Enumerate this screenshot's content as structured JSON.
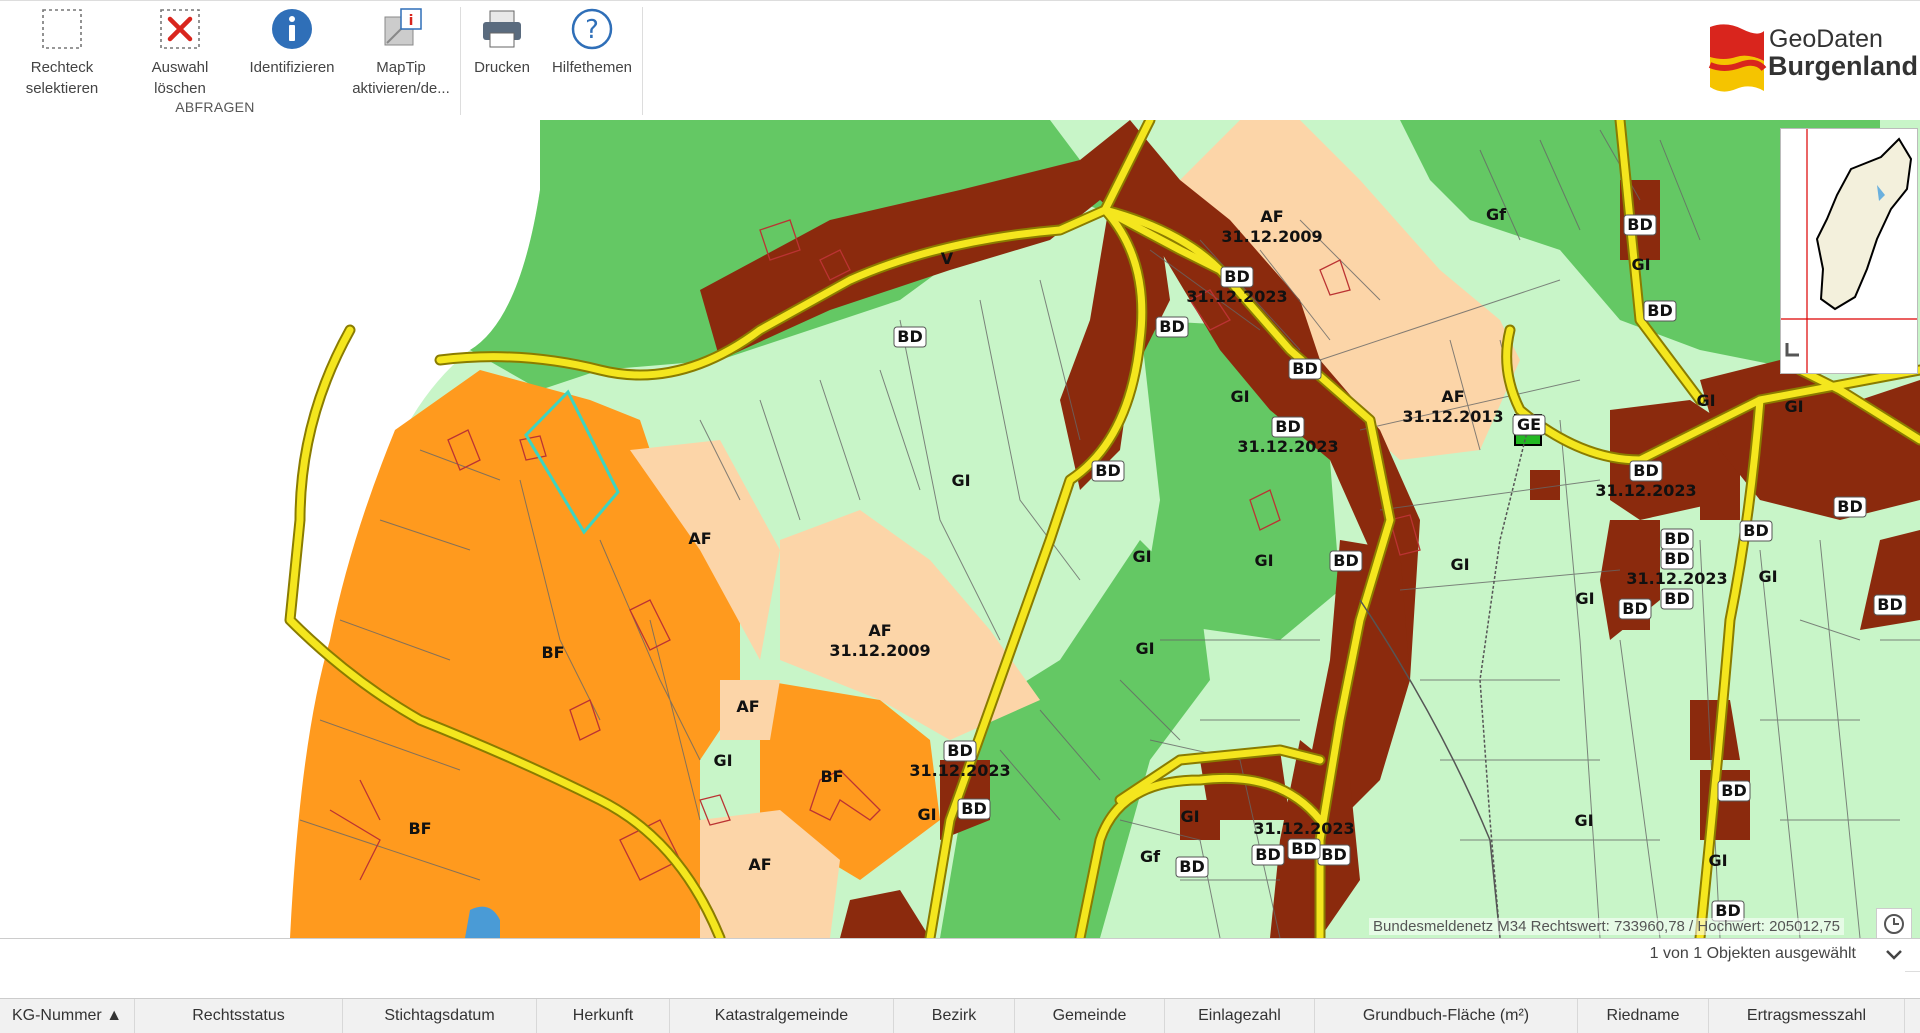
{
  "toolbar": {
    "buttons": [
      {
        "label": "Rechteck selektieren",
        "icon": "rectangle-select-icon"
      },
      {
        "label": "Auswahl löschen",
        "icon": "clear-selection-icon"
      },
      {
        "label": "Identifizieren",
        "icon": "info-icon"
      },
      {
        "label": "MapTip aktivieren/de...",
        "icon": "maptip-icon"
      },
      {
        "label": "Drucken",
        "icon": "printer-icon"
      },
      {
        "label": "Hilfethemen",
        "icon": "help-icon"
      }
    ],
    "group_label": "ABFRAGEN"
  },
  "logo": {
    "line1": "GeoDaten",
    "line2": "Burgenland",
    "colors": [
      "#d9251d",
      "#f5c400"
    ]
  },
  "map": {
    "labels": [
      {
        "text": "V"
      },
      {
        "text": "BD"
      },
      {
        "text": "AF"
      },
      {
        "text": "31.12.2009"
      },
      {
        "text": "BD"
      },
      {
        "text": "31.12.2023"
      },
      {
        "text": "BD"
      },
      {
        "text": "BD"
      },
      {
        "text": "GI"
      },
      {
        "text": "BD"
      },
      {
        "text": "31.12.2023"
      },
      {
        "text": "AF"
      },
      {
        "text": "31.12.2013"
      },
      {
        "text": "GI"
      },
      {
        "text": "Gf"
      },
      {
        "text": "BD"
      },
      {
        "text": "BD"
      },
      {
        "text": "GI"
      },
      {
        "text": "GI"
      },
      {
        "text": "AF"
      },
      {
        "text": "BF"
      },
      {
        "text": "AF"
      },
      {
        "text": "31.12.2009"
      },
      {
        "text": "AF"
      },
      {
        "text": "GI"
      },
      {
        "text": "BF"
      },
      {
        "text": "BD"
      },
      {
        "text": "31.12.2023"
      },
      {
        "text": "GI"
      },
      {
        "text": "BD"
      },
      {
        "text": "BF"
      },
      {
        "text": "AF"
      },
      {
        "text": "GI"
      },
      {
        "text": "BD"
      },
      {
        "text": "GI"
      },
      {
        "text": "GE"
      },
      {
        "text": "GI"
      },
      {
        "text": "GI"
      },
      {
        "text": "BD"
      },
      {
        "text": "31.12.2023"
      },
      {
        "text": "BD"
      },
      {
        "text": "BD"
      },
      {
        "text": "31.12.2023"
      },
      {
        "text": "BD"
      },
      {
        "text": "BD"
      },
      {
        "text": "GI"
      },
      {
        "text": "Gf"
      },
      {
        "text": "GI"
      },
      {
        "text": "BD"
      },
      {
        "text": "BD"
      },
      {
        "text": "BD"
      },
      {
        "text": "31.12.2023"
      },
      {
        "text": "BD"
      },
      {
        "text": "GI"
      },
      {
        "text": "GI"
      },
      {
        "text": "BD"
      },
      {
        "text": "BD"
      },
      {
        "text": "BD"
      },
      {
        "text": "GI"
      },
      {
        "text": "GI"
      },
      {
        "text": "BD"
      },
      {
        "text": "BD"
      },
      {
        "text": "BD"
      }
    ],
    "coordinates": "Bundesmeldenetz M34 Rechtswert: 733960,78 / Hochwert: 205012,75",
    "colors": {
      "forest": "#64c864",
      "meadow": "#c8f5c8",
      "built": "#8b2a0d",
      "af": "#fcd5a8",
      "bf": "#ff9a1e",
      "road": "#f4e61e"
    }
  },
  "status": {
    "selection": "1 von 1 Objekten ausgewählt"
  },
  "table": {
    "columns": [
      "KG-Nummer ▲",
      "Rechtsstatus",
      "Stichtagsdatum",
      "Herkunft",
      "Katastralgemeinde",
      "Bezirk",
      "Gemeinde",
      "Einlagezahl",
      "Grundbuch-Fläche (m²)",
      "Riedname",
      "Ertragsmesszahl"
    ]
  }
}
